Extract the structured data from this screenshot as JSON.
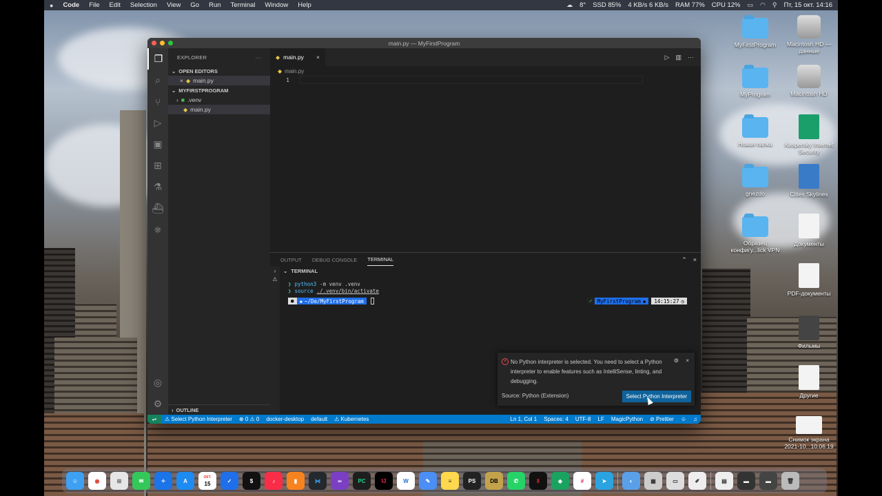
{
  "menubar": {
    "app": "Code",
    "items": [
      "File",
      "Edit",
      "Selection",
      "View",
      "Go",
      "Run",
      "Terminal",
      "Window",
      "Help"
    ],
    "weather": "8°",
    "ssd": "SSD 85%",
    "net": "4 KB/s 6 KB/s",
    "ram": "RAM 77%",
    "cpu": "CPU 12%",
    "clock": "Пт, 15 окт. 14:16"
  },
  "desktop": [
    "MyFirstProgram",
    "Macintosh HD — данные",
    "MyProgram",
    "Macintosh HD",
    "Новая папка",
    "Kaspersky Internet Security",
    "gnezdo",
    "Cities Skylines",
    "Образец конфигу...lick VPN",
    "Документы",
    "PDF-документы",
    "Фильмы",
    "Другие",
    "Снимок экрана 2021-10...10.06.19"
  ],
  "window": {
    "title": "main.py — MyFirstProgram"
  },
  "sidebar": {
    "title": "EXPLORER",
    "open_editors": "OPEN EDITORS",
    "open_file": "main.py",
    "project": "MYFIRSTPROGRAM",
    "venv": ".venv",
    "file": "main.py",
    "outline": "OUTLINE"
  },
  "editor": {
    "tab": "main.py",
    "breadcrumb": "main.py",
    "line_number": "1"
  },
  "panel": {
    "tabs": [
      "OUTPUT",
      "DEBUG CONSOLE",
      "TERMINAL"
    ],
    "terminal_header": "TERMINAL",
    "line1_cmd": "python3",
    "line1_rest": "-m venv .venv",
    "line2_cmd": "source",
    "line2_rest": "./.venv/bin/activate",
    "prompt_path": "~/De/MyFirstProgram",
    "prompt_venv": "MyFirstProgram",
    "prompt_time": "14:15:27"
  },
  "notification": {
    "message": "No Python interpreter is selected. You need to select a Python interpreter to enable features such as IntelliSense, linting, and debugging.",
    "source": "Source: Python (Extension)",
    "button": "Select Python Interpreter"
  },
  "statusbar": {
    "interp": "Select Python Interpreter",
    "problems": "⊗ 0 ⚠ 0",
    "context": "docker-desktop",
    "namespace": "default",
    "k8s": "Kubernetes",
    "position": "Ln 1, Col 1",
    "spaces": "Spaces: 4",
    "encoding": "UTF-8",
    "eol": "LF",
    "magic": "MagicPython",
    "prettier": "Prettier"
  },
  "dock": {
    "calendar_month": "ОКТ.",
    "calendar_day": "15"
  },
  "colors": {
    "accent": "#007acc",
    "remote": "#16825d",
    "button": "#0e639c",
    "error": "#f14c4c"
  }
}
